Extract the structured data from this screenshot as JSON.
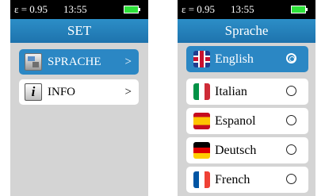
{
  "left_screen": {
    "status": {
      "emissivity": "ε = 0.95",
      "time": "13:55"
    },
    "title": "SET",
    "items": [
      {
        "label": "SPRACHE",
        "chevron": ">",
        "icon": "language-icon",
        "selected": true
      },
      {
        "label": "INFO",
        "chevron": ">",
        "icon": "info-icon",
        "selected": false
      }
    ]
  },
  "right_screen": {
    "status": {
      "emissivity": "ε = 0.95",
      "time": "13:55"
    },
    "title": "Sprache",
    "languages": [
      {
        "label": "English",
        "flag": "uk-flag-icon",
        "selected": true
      },
      {
        "label": "Italian",
        "flag": "italy-flag-icon",
        "selected": false
      },
      {
        "label": "Espanol",
        "flag": "spain-flag-icon",
        "selected": false
      },
      {
        "label": "Deutsch",
        "flag": "germany-flag-icon",
        "selected": false
      },
      {
        "label": "French",
        "flag": "france-flag-icon",
        "selected": false
      }
    ]
  },
  "colors": {
    "statusbar": "#000000",
    "titlebar": "#1e7fbf",
    "selected": "#2b87c4",
    "screen_bg": "#d4d4d4",
    "battery": "#2ee23a"
  }
}
